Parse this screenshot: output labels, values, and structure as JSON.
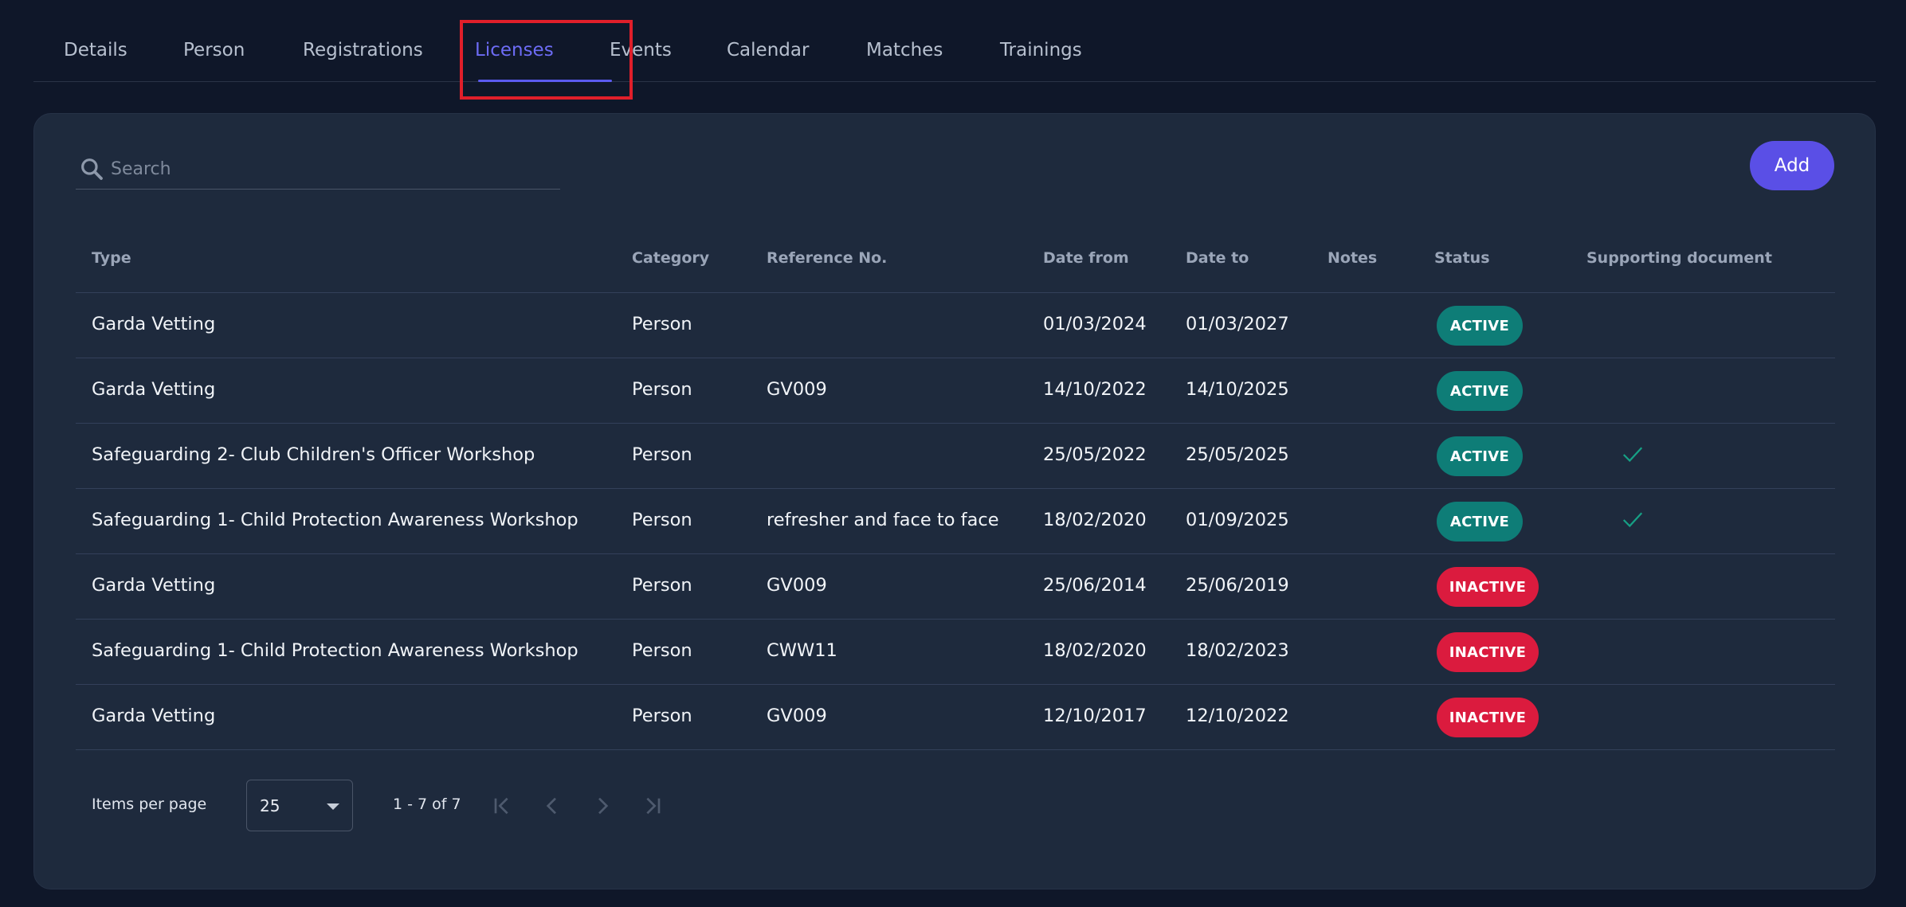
{
  "tabs": [
    {
      "label": "Details"
    },
    {
      "label": "Person"
    },
    {
      "label": "Registrations"
    },
    {
      "label": "Licenses",
      "active": true
    },
    {
      "label": "Events"
    },
    {
      "label": "Calendar"
    },
    {
      "label": "Matches"
    },
    {
      "label": "Trainings"
    }
  ],
  "search": {
    "placeholder": "Search",
    "icon": "search-icon"
  },
  "add_button": {
    "label": "Add"
  },
  "table": {
    "columns": [
      "Type",
      "Category",
      "Reference No.",
      "Date from",
      "Date to",
      "Notes",
      "Status",
      "Supporting document"
    ],
    "rows": [
      {
        "type": "Garda Vetting",
        "category": "Person",
        "reference": "",
        "date_from": "01/03/2024",
        "date_to": "01/03/2027",
        "notes": "",
        "status": "ACTIVE",
        "doc": false
      },
      {
        "type": "Garda Vetting",
        "category": "Person",
        "reference": "GV009",
        "date_from": "14/10/2022",
        "date_to": "14/10/2025",
        "notes": "",
        "status": "ACTIVE",
        "doc": false
      },
      {
        "type": "Safeguarding 2- Club Children's Officer Workshop",
        "category": "Person",
        "reference": "",
        "date_from": "25/05/2022",
        "date_to": "25/05/2025",
        "notes": "",
        "status": "ACTIVE",
        "doc": true
      },
      {
        "type": "Safeguarding 1- Child Protection Awareness Workshop",
        "category": "Person",
        "reference": "refresher and face to face",
        "date_from": "18/02/2020",
        "date_to": "01/09/2025",
        "notes": "",
        "status": "ACTIVE",
        "doc": true
      },
      {
        "type": "Garda Vetting",
        "category": "Person",
        "reference": "GV009",
        "date_from": "25/06/2014",
        "date_to": "25/06/2019",
        "notes": "",
        "status": "INACTIVE",
        "doc": false
      },
      {
        "type": "Safeguarding 1- Child Protection Awareness Workshop",
        "category": "Person",
        "reference": "CWW11",
        "date_from": "18/02/2020",
        "date_to": "18/02/2023",
        "notes": "",
        "status": "INACTIVE",
        "doc": false
      },
      {
        "type": "Garda Vetting",
        "category": "Person",
        "reference": "GV009",
        "date_from": "12/10/2017",
        "date_to": "12/10/2022",
        "notes": "",
        "status": "INACTIVE",
        "doc": false
      }
    ]
  },
  "pagination": {
    "items_per_page_label": "Items per page",
    "items_per_page_value": "25",
    "range_label": "1 - 7 of 7"
  },
  "colors": {
    "background": "#0f1729",
    "card": "#1e2a3d",
    "accent": "#5a4fe6",
    "active_tab": "#6d6cf5",
    "status_active": "#0e7d77",
    "status_inactive": "#db1b3e",
    "check": "#16a085",
    "highlight": "#e01f2a"
  }
}
